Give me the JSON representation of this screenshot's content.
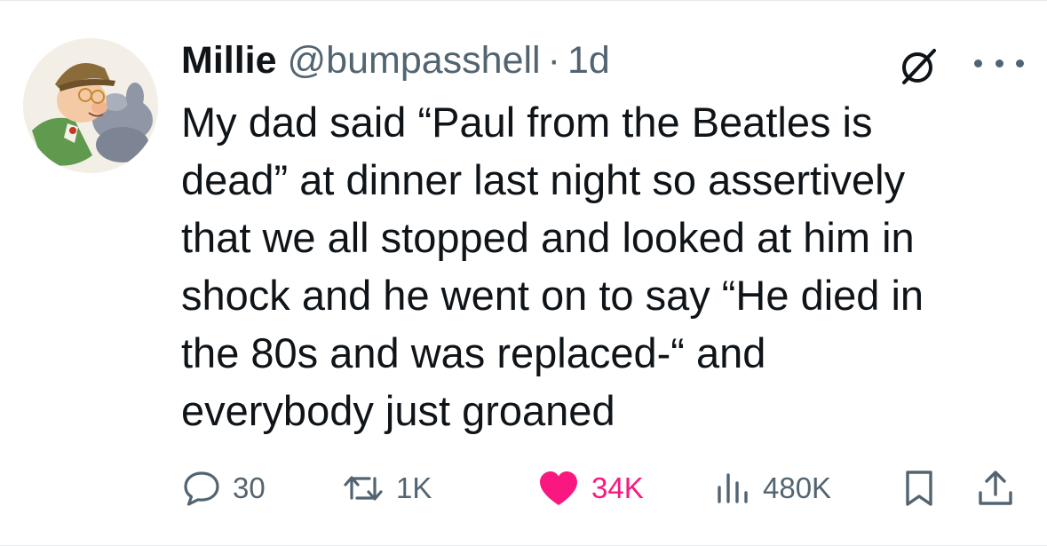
{
  "tweet": {
    "author_name": "Millie",
    "handle": "@bumpasshell",
    "separator": "·",
    "time": "1d",
    "text_lines": [
      "My dad said “Paul from the Beatles is",
      "dead” at dinner last night so assertively",
      "that we all stopped and looked at him in",
      "shock and he went on to say “He died in",
      "the 80s and was replaced-“ and",
      "everybody just groaned"
    ]
  },
  "actions": {
    "replies": "30",
    "reposts": "1K",
    "likes": "34K",
    "views": "480K"
  },
  "icons": {
    "reply": "speech-bubble-icon",
    "repost": "repost-arrows-icon",
    "like": "heart-icon",
    "views": "bar-chart-icon",
    "bookmark": "bookmark-icon",
    "share": "share-upload-icon",
    "grok": "grok-slash-circle-icon",
    "more": "more-dots-icon"
  },
  "colors": {
    "text_primary": "#0f1419",
    "text_secondary": "#536471",
    "like_active": "#f91880"
  }
}
